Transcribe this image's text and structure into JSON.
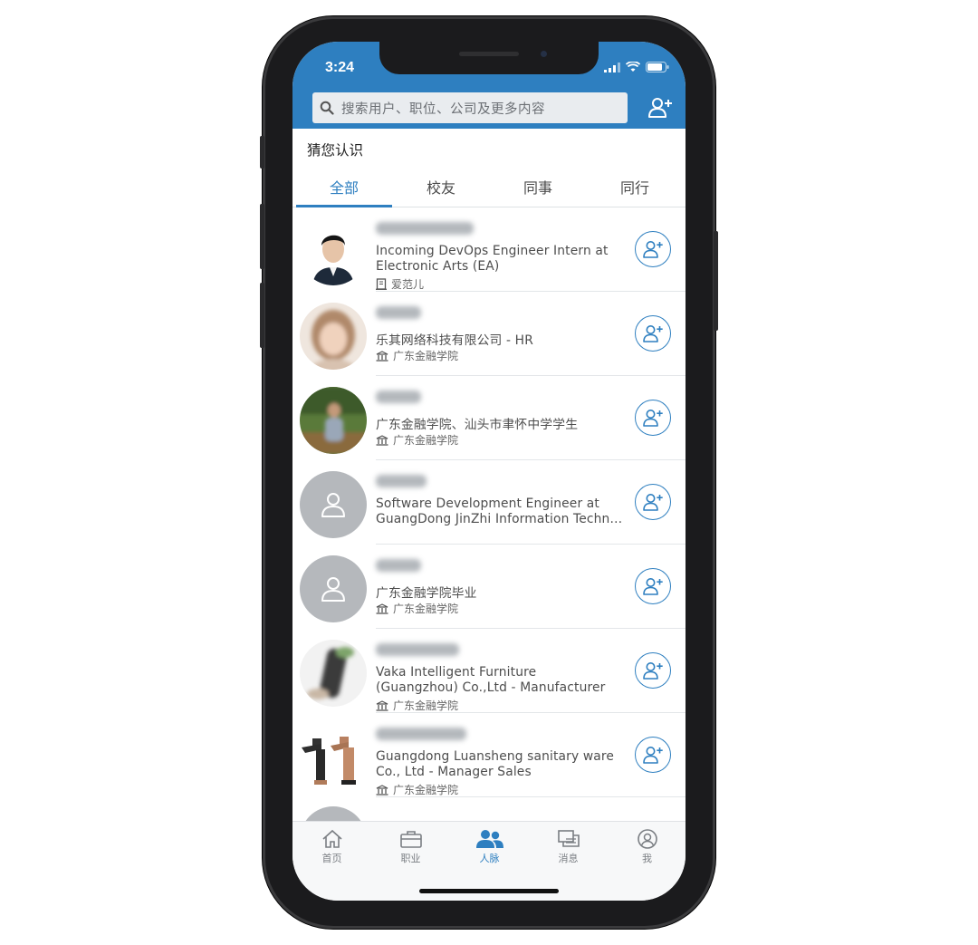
{
  "status_bar": {
    "time": "3:24"
  },
  "search": {
    "placeholder": "搜索用户、职位、公司及更多内容"
  },
  "section_title": "猜您认识",
  "tabs": [
    {
      "label": "全部"
    },
    {
      "label": "校友"
    },
    {
      "label": "同事"
    },
    {
      "label": "同行"
    }
  ],
  "active_tab": "全部",
  "people": [
    {
      "line1": "Incoming DevOps Engineer Intern at",
      "line2": "Electronic Arts (EA)",
      "meta_icon": "building-icon",
      "meta": "爱范儿"
    },
    {
      "line1": "乐其网络科技有限公司 - HR",
      "line2": "",
      "meta_icon": "school-icon",
      "meta": "广东金融学院"
    },
    {
      "line1": "广东金融学院、汕头市聿怀中学学生",
      "line2": "",
      "meta_icon": "school-icon",
      "meta": "广东金融学院"
    },
    {
      "line1": "Software Development Engineer at",
      "line2": "GuangDong JinZhi Information Techn…",
      "meta_icon": "",
      "meta": ""
    },
    {
      "line1": "广东金融学院毕业",
      "line2": "",
      "meta_icon": "school-icon",
      "meta": "广东金融学院"
    },
    {
      "line1": "Vaka Intelligent Furniture",
      "line2": "(Guangzhou) Co.,Ltd - Manufacturer",
      "meta_icon": "school-icon",
      "meta": "广东金融学院"
    },
    {
      "line1": "Guangdong Luansheng sanitary ware",
      "line2": "Co., Ltd - Manager Sales",
      "meta_icon": "school-icon",
      "meta": "广东金融学院"
    }
  ],
  "tabbar": [
    {
      "label": "首页",
      "icon": "home-icon"
    },
    {
      "label": "职业",
      "icon": "briefcase-icon"
    },
    {
      "label": "人脉",
      "icon": "people-icon"
    },
    {
      "label": "消息",
      "icon": "messages-icon"
    },
    {
      "label": "我",
      "icon": "profile-icon"
    }
  ],
  "colors": {
    "brand": "#2e7fc0"
  }
}
